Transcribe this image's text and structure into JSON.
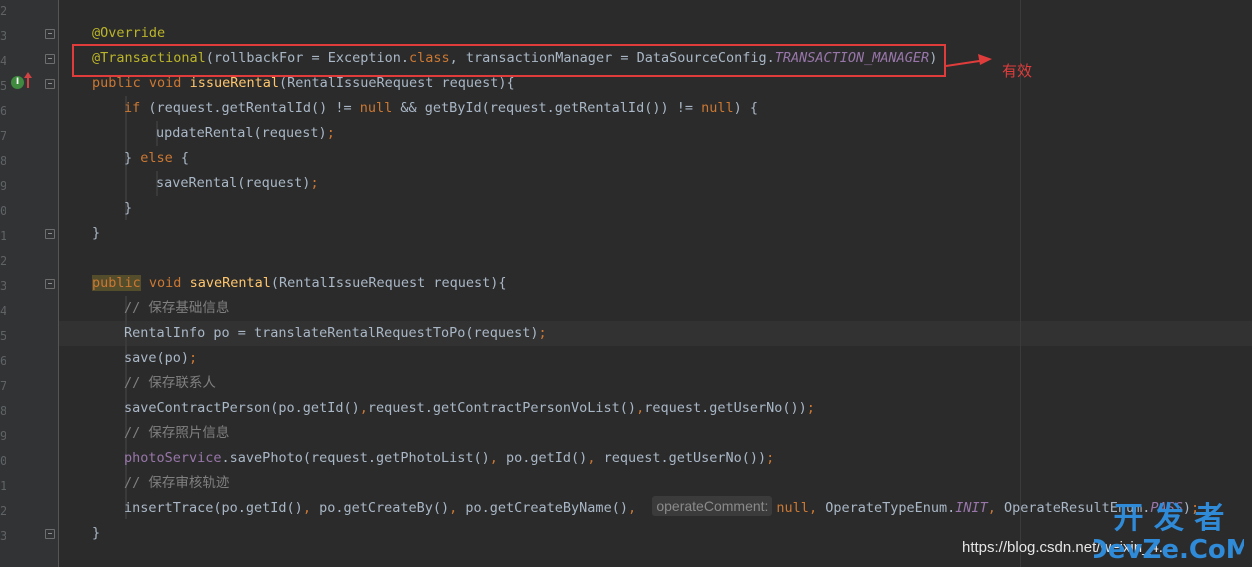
{
  "editor": {
    "colors": {
      "background": "#2b2b2b",
      "keyword": "#cc7832",
      "annotation": "#bbb529",
      "method": "#ffc66d",
      "comment": "#808080",
      "constant": "#9876aa",
      "text": "#a9b7c6"
    },
    "gutter": {
      "line_number_stubs": [
        "2",
        "3",
        "4",
        "5",
        "6",
        "7",
        "8",
        "9",
        "0",
        "1",
        "2",
        "3",
        "4",
        "5",
        "6",
        "7",
        "8",
        "9",
        "0",
        "1",
        "2",
        "3"
      ],
      "implement_icon": "implementing-method-icon",
      "override_arrow_icon": "override-up-arrow-icon"
    },
    "code": {
      "l1": {
        "ann": "@Override"
      },
      "l2": {
        "ann": "@Transactional",
        "a": "(rollbackFor = Exception.",
        "kw1": "class",
        "b": ", transactionManager = DataSourceConfig.",
        "cst": "TRANSACTION_MANAGER",
        "c": ")"
      },
      "l3": {
        "kw1": "public",
        "kw2": "void",
        "fn": "issueRental",
        "a": "(RentalIssueRequest request){"
      },
      "l4": {
        "kw1": "if",
        "a": " (request.getRentalId() != ",
        "kw2": "null",
        "b": " && getById(request.getRentalId()) != ",
        "kw3": "null",
        "c": ") {"
      },
      "l5": {
        "a": "updateRental(request)",
        "semi": ";"
      },
      "l6": {
        "a": "} ",
        "kw1": "else",
        "b": " {"
      },
      "l7": {
        "a": "saveRental(request)",
        "semi": ";"
      },
      "l8": {
        "a": "}"
      },
      "l9": {
        "a": "}"
      },
      "l10": {
        "kw1": "public",
        "kw2": "void",
        "fn": "saveRental",
        "a": "(RentalIssueRequest request){"
      },
      "l11": {
        "cmt": "// 保存基础信息"
      },
      "l12": {
        "a": "RentalInfo po = translateRentalRequestToPo(request)",
        "semi": ";"
      },
      "l13": {
        "a": "save(po)",
        "semi": ";"
      },
      "l14": {
        "cmt": "// 保存联系人"
      },
      "l15": {
        "a": "saveContractPerson(po.getId()",
        "c1": ",",
        "b": "request.getContractPersonVoList()",
        "c2": ",",
        "c": "request.getUserNo())",
        "semi": ";"
      },
      "l16": {
        "cmt": "// 保存照片信息"
      },
      "l17": {
        "fld": "photoService",
        "a": ".savePhoto(request.getPhotoList()",
        "c1": ",",
        "b": " po.getId()",
        "c2": ",",
        "c": " request.getUserNo())",
        "semi": ";"
      },
      "l18": {
        "cmt": "// 保存审核轨迹"
      },
      "l19": {
        "a": "insertTrace(po.getId()",
        "c1": ",",
        "b": " po.getCreateBy()",
        "c2": ",",
        "c": " po.getCreateByName()",
        "c3": ",",
        "hint": "operateComment:",
        "kw1": "null",
        "c4": ",",
        "d": " OperateTypeEnum.",
        "cst1": "INIT",
        "c5": ",",
        "e": " OperateResultEnum.",
        "cst2": "PASS",
        "f": ")",
        "semi": ";"
      },
      "l20": {
        "a": "}"
      }
    }
  },
  "annotation_overlay": {
    "label": "有效",
    "color": "#e03c3c"
  },
  "watermark": {
    "url": "https://blog.csdn.net/weixin_4...",
    "logo_line1": "开 发 者",
    "logo_line2": "DevZe.CoM"
  }
}
